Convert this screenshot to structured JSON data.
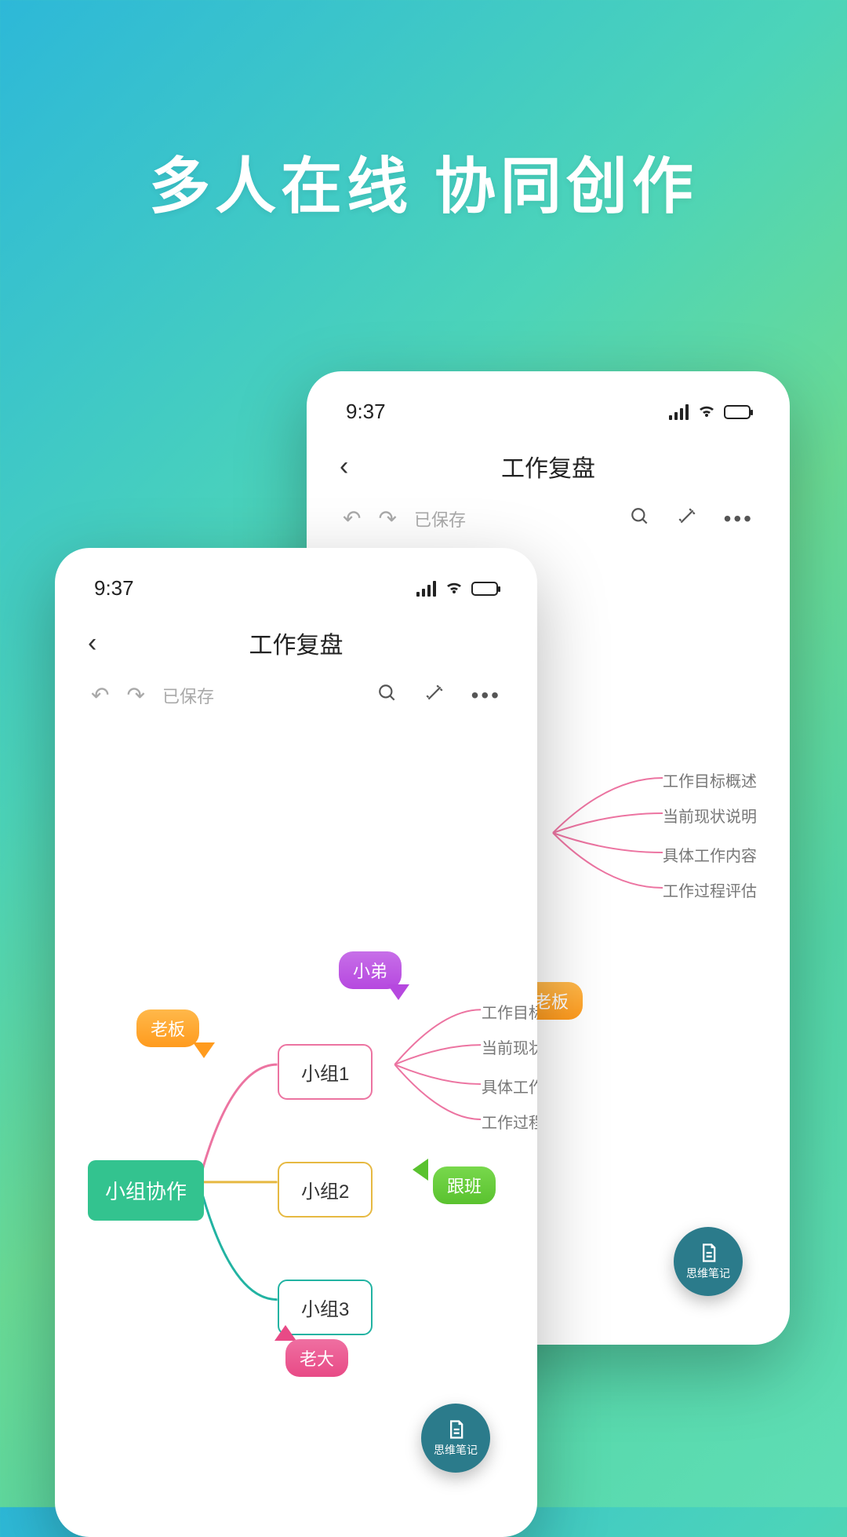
{
  "page": {
    "headline": "多人在线 协同创作"
  },
  "phone": {
    "status_time": "9:37",
    "doc_title": "工作复盘",
    "saved_label": "已保存",
    "root_label": "小组协作",
    "branch1": "小组1",
    "branch2": "小组2",
    "branch3": "小组3",
    "leaf1": "工作目标概述",
    "leaf2": "当前现状说明",
    "leaf3": "具体工作内容",
    "leaf4": "工作过程评估",
    "tag_boss": "老板",
    "tag_brother": "小弟",
    "tag_follow": "跟班",
    "tag_elder": "老大",
    "fab_label": "思维笔记"
  },
  "colors": {
    "pink": "#ec74a1",
    "gold": "#e6b942",
    "teal": "#22b3a2"
  }
}
